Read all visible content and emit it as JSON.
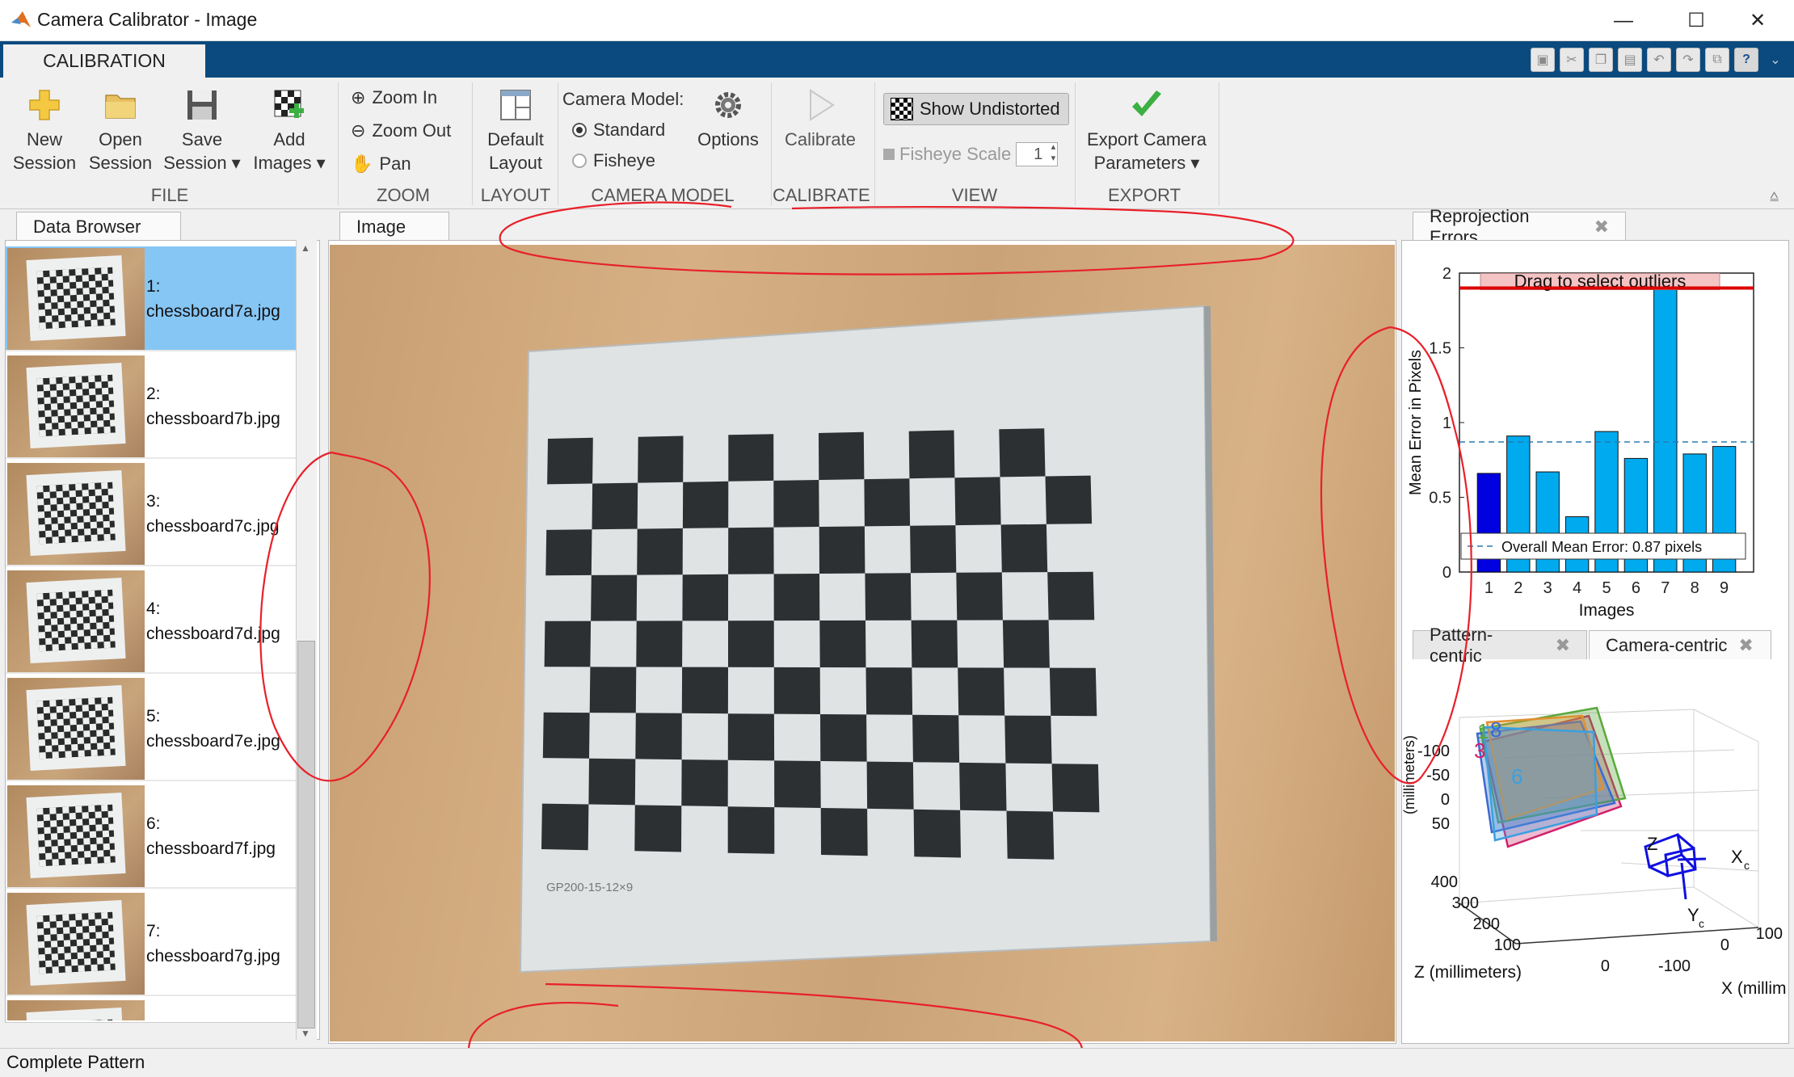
{
  "window": {
    "title": "Camera Calibrator - Image"
  },
  "ribbon": {
    "tab": "CALIBRATION",
    "file": {
      "group": "FILE",
      "new_session": [
        "New",
        "Session"
      ],
      "open_session": [
        "Open",
        "Session"
      ],
      "save_session": [
        "Save",
        "Session ▾"
      ],
      "add_images": [
        "Add",
        "Images ▾"
      ]
    },
    "zoom": {
      "group": "ZOOM",
      "zoom_in": "Zoom In",
      "zoom_out": "Zoom Out",
      "pan": "Pan"
    },
    "layout": {
      "group": "LAYOUT",
      "default_layout": [
        "Default",
        "Layout"
      ]
    },
    "camera_model": {
      "group": "CAMERA MODEL",
      "label": "Camera Model:",
      "standard": "Standard",
      "fisheye": "Fisheye",
      "options": "Options",
      "selected": "Standard"
    },
    "calibrate": {
      "group": "CALIBRATE",
      "calibrate": "Calibrate"
    },
    "view": {
      "group": "VIEW",
      "show_undistorted": "Show Undistorted",
      "fisheye_scale": "Fisheye Scale",
      "fisheye_scale_value": "1"
    },
    "export": {
      "group": "EXPORT",
      "export_params": [
        "Export Camera",
        "Parameters ▾"
      ]
    }
  },
  "data_browser": {
    "tab": "Data Browser",
    "selected_index": 0,
    "items": [
      {
        "num": "1:",
        "file": "chessboard7a.jpg"
      },
      {
        "num": "2:",
        "file": "chessboard7b.jpg"
      },
      {
        "num": "3:",
        "file": "chessboard7c.jpg"
      },
      {
        "num": "4:",
        "file": "chessboard7d.jpg"
      },
      {
        "num": "5:",
        "file": "chessboard7e.jpg"
      },
      {
        "num": "6:",
        "file": "chessboard7f.jpg"
      },
      {
        "num": "7:",
        "file": "chessboard7g.jpg"
      }
    ]
  },
  "image_panel": {
    "tab": "Image",
    "board_caption": "GP200-15-12×9"
  },
  "reprojection": {
    "tab": "Reprojection Errors",
    "drag_label": "Drag to select outliers",
    "overall_label": "Overall Mean Error: 0.87 pixels"
  },
  "extrinsics": {
    "tab_pattern": "Pattern-centric",
    "tab_camera": "Camera-centric",
    "active_tab": "Camera-centric",
    "y_ticks": [
      "-100",
      "-50",
      "0",
      "50"
    ],
    "z_ticks": [
      "400",
      "300",
      "200",
      "100",
      "0"
    ],
    "x_ticks": [
      "-100",
      "0",
      "100"
    ],
    "z_label": "Z (millimeters)",
    "x_label": "X (millim",
    "y_label": "(millimeters)",
    "axis_x": "X",
    "axis_x_sub": "c",
    "axis_y": "Y",
    "axis_y_sub": "c",
    "axis_z": "Z",
    "plane_labels": [
      "1",
      "8",
      "3",
      "6"
    ]
  },
  "status": {
    "text": "Complete Pattern"
  },
  "chart_data": {
    "type": "bar",
    "categories": [
      "1",
      "2",
      "3",
      "4",
      "5",
      "6",
      "7",
      "8",
      "9"
    ],
    "values": [
      0.66,
      0.91,
      0.67,
      0.37,
      0.94,
      0.76,
      1.94,
      0.79,
      0.84
    ],
    "selected_index": 0,
    "mean": 0.87,
    "threshold": 1.9,
    "xlabel": "Images",
    "ylabel": "Mean Error in Pixels",
    "ylim": [
      0,
      2
    ],
    "yticks": [
      0,
      0.5,
      1,
      1.5,
      2
    ],
    "bar_color": "#00aaee",
    "selected_color": "#0000e0",
    "threshold_color": "#dd0000"
  }
}
